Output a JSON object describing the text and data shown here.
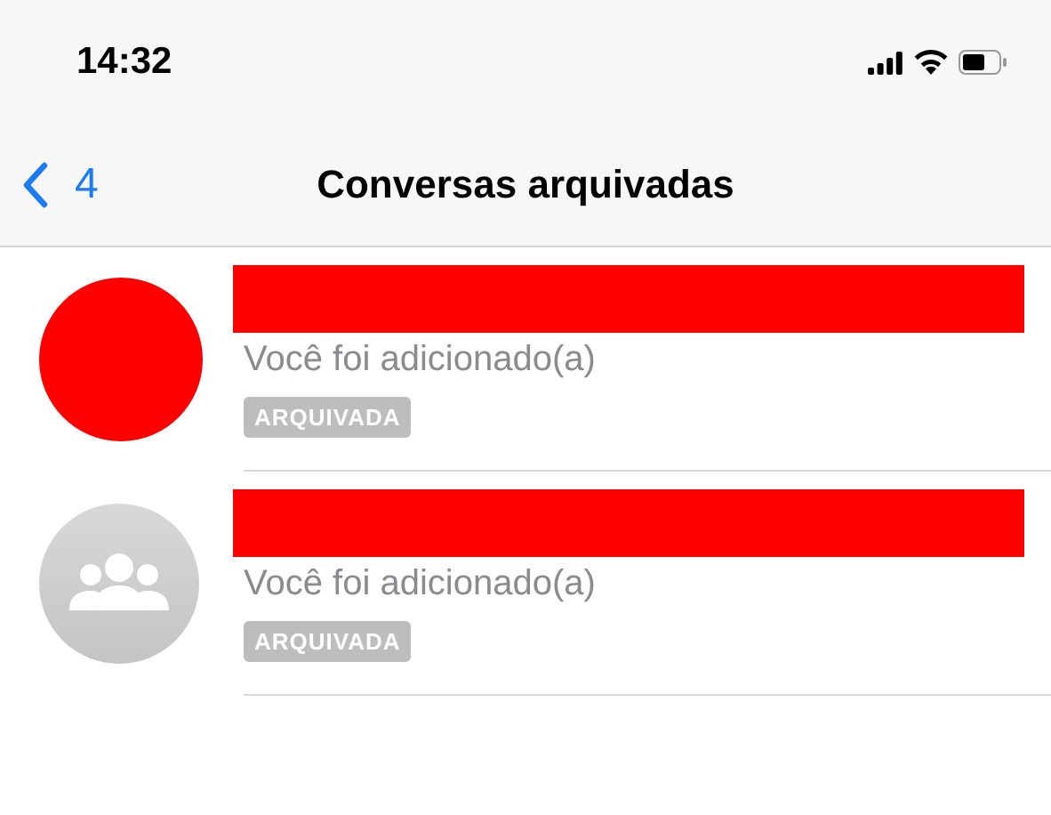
{
  "status_bar": {
    "time": "14:32"
  },
  "nav": {
    "back_label": "4",
    "title": "Conversas arquivadas"
  },
  "chats": [
    {
      "kind": "redacted",
      "name_redacted": true,
      "preview": "Você foi adicionado(a)",
      "badge": "ARQUIVADA"
    },
    {
      "kind": "group",
      "name_redacted": true,
      "preview": "Você foi adicionado(a)",
      "badge": "ARQUIVADA"
    }
  ]
}
